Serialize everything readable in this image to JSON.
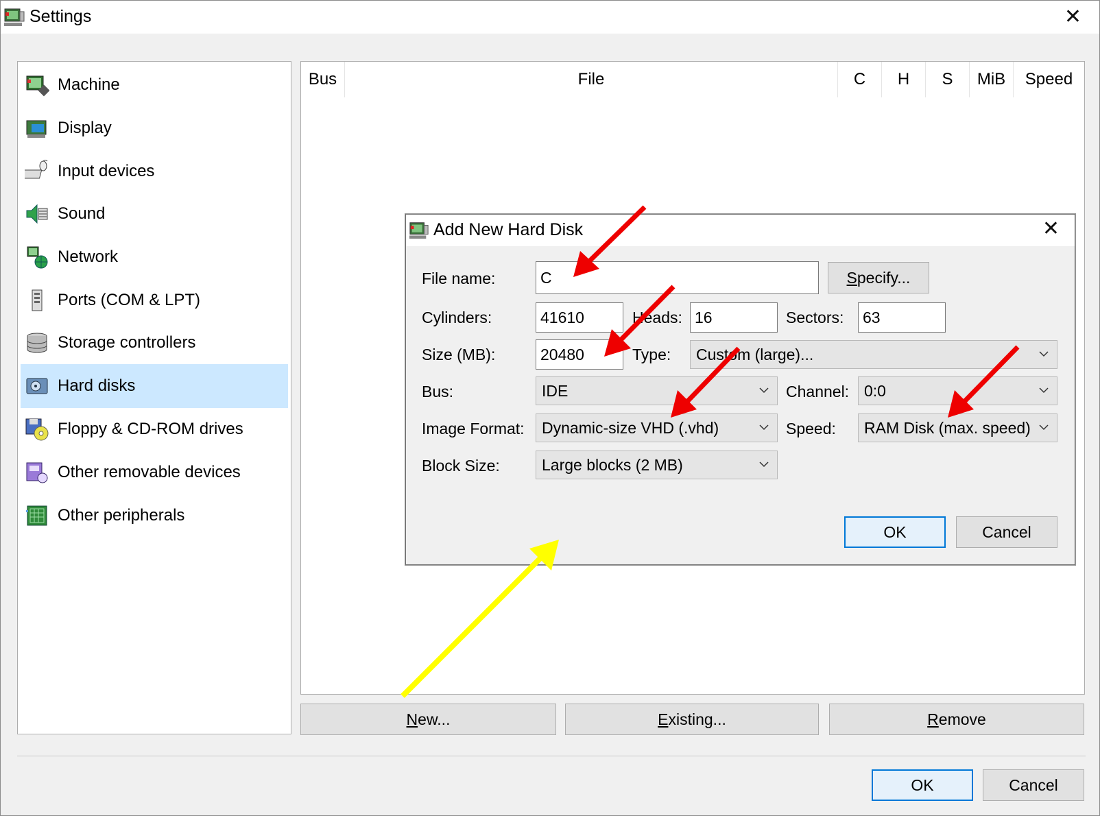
{
  "window": {
    "title": "Settings",
    "close_glyph": "✕"
  },
  "sidebar": {
    "items": [
      {
        "label": "Machine",
        "icon": "machine-icon"
      },
      {
        "label": "Display",
        "icon": "display-icon"
      },
      {
        "label": "Input devices",
        "icon": "input-devices-icon"
      },
      {
        "label": "Sound",
        "icon": "sound-icon"
      },
      {
        "label": "Network",
        "icon": "network-icon"
      },
      {
        "label": "Ports (COM & LPT)",
        "icon": "ports-icon"
      },
      {
        "label": "Storage controllers",
        "icon": "storage-controllers-icon"
      },
      {
        "label": "Hard disks",
        "icon": "hard-disks-icon",
        "selected": true
      },
      {
        "label": "Floppy & CD-ROM drives",
        "icon": "floppy-cdrom-icon"
      },
      {
        "label": "Other removable devices",
        "icon": "removable-devices-icon"
      },
      {
        "label": "Other peripherals",
        "icon": "peripherals-icon"
      }
    ]
  },
  "disk_list": {
    "columns": [
      "Bus",
      "File",
      "C",
      "H",
      "S",
      "MiB",
      "Speed"
    ]
  },
  "disk_buttons": {
    "new_ul": "N",
    "new_rest": "ew...",
    "existing_ul": "E",
    "existing_rest": "xisting...",
    "remove_ul": "R",
    "remove_rest": "emove"
  },
  "footer": {
    "ok": "OK",
    "cancel": "Cancel"
  },
  "dialog": {
    "title": "Add New Hard Disk",
    "close_glyph": "✕",
    "file_name_label": "File name:",
    "file_name_value": "C",
    "specify_ul": "S",
    "specify_rest": "pecify...",
    "cylinders_label": "Cylinders:",
    "cylinders_value": "41610",
    "heads_label": "Heads:",
    "heads_value": "16",
    "sectors_label": "Sectors:",
    "sectors_value": "63",
    "size_label": "Size (MB):",
    "size_value": "20480",
    "type_label": "Type:",
    "type_value": "Custom (large)...",
    "bus_label": "Bus:",
    "bus_value": "IDE",
    "channel_label": "Channel:",
    "channel_value": "0:0",
    "image_format_label": "Image Format:",
    "image_format_value": "Dynamic-size VHD (.vhd)",
    "speed_label": "Speed:",
    "speed_value": "RAM Disk (max. speed)",
    "block_size_label": "Block Size:",
    "block_size_value": "Large blocks (2 MB)",
    "ok": "OK",
    "cancel": "Cancel"
  },
  "annotations": {
    "red_arrow_color": "#ee0000",
    "yellow_arrow_color": "#ffff00"
  }
}
